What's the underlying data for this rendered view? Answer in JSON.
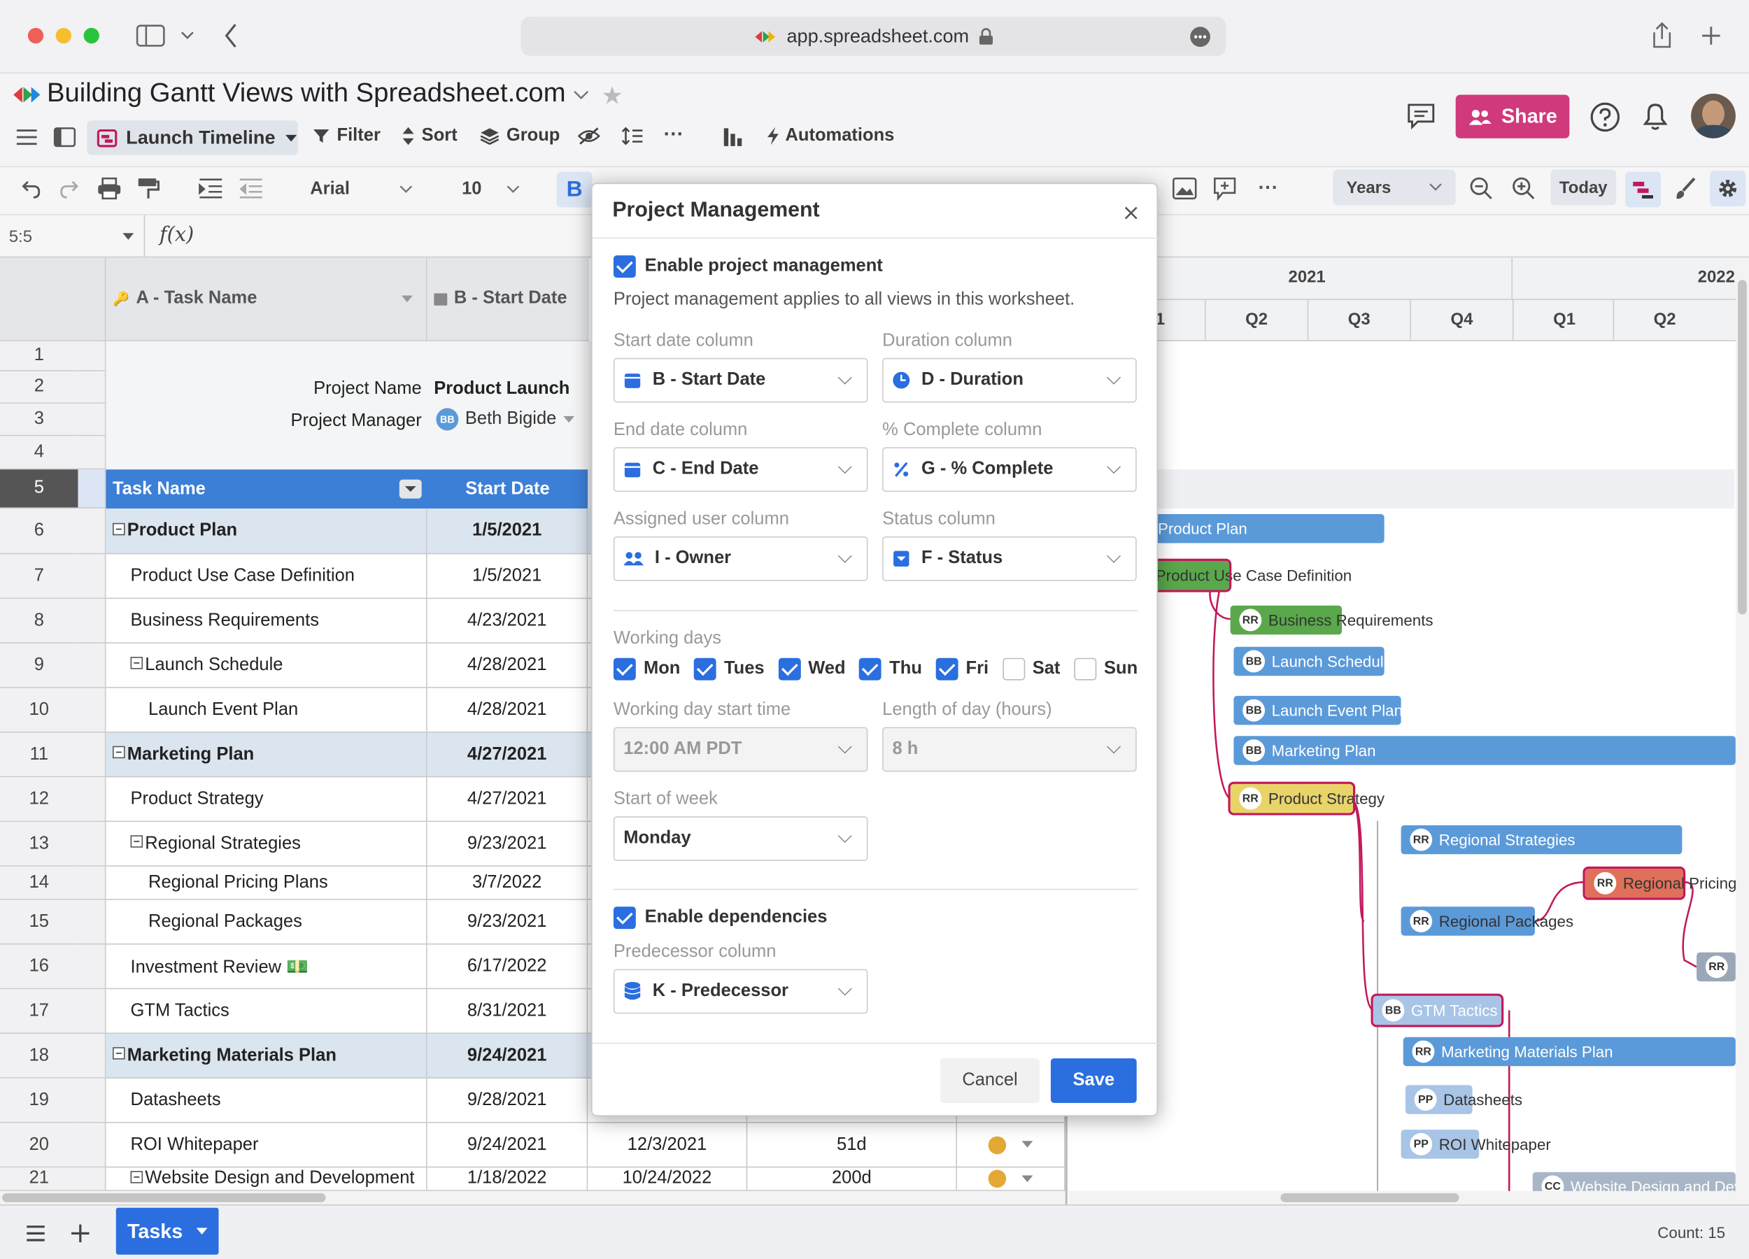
{
  "browser": {
    "url": "app.spreadsheet.com"
  },
  "header": {
    "title": "Building Gantt Views with Spreadsheet.com",
    "view_name": "Launch Timeline",
    "filter": "Filter",
    "sort": "Sort",
    "group": "Group",
    "automations": "Automations",
    "share": "Share"
  },
  "format_bar": {
    "font": "Arial",
    "size": "10",
    "zoom_unit": "Years",
    "today": "Today"
  },
  "formula_bar": {
    "cell_ref": "5:5",
    "fx": "f(x)"
  },
  "columns": {
    "a": "A - Task Name",
    "b": "B - Start Date"
  },
  "project_info": {
    "name_label": "Project Name",
    "name_value": "Product Launch",
    "manager_label": "Project Manager",
    "manager_value": "Beth Bigide",
    "manager_initials": "BB"
  },
  "table_header": {
    "task": "Task Name",
    "start": "Start Date"
  },
  "rows": [
    {
      "n": "1"
    },
    {
      "n": "2"
    },
    {
      "n": "3"
    },
    {
      "n": "4"
    },
    {
      "n": "5"
    },
    {
      "n": "6",
      "task": "Product Plan",
      "start": "1/5/2021",
      "group": true
    },
    {
      "n": "7",
      "task": "Product Use Case Definition",
      "start": "1/5/2021"
    },
    {
      "n": "8",
      "task": "Business Requirements",
      "start": "4/23/2021"
    },
    {
      "n": "9",
      "task": "Launch Schedule",
      "start": "4/28/2021",
      "sub": true
    },
    {
      "n": "10",
      "task": "Launch Event Plan",
      "start": "4/28/2021",
      "indent": true
    },
    {
      "n": "11",
      "task": "Marketing Plan",
      "start": "4/27/2021",
      "group": true
    },
    {
      "n": "12",
      "task": "Product Strategy",
      "start": "4/27/2021"
    },
    {
      "n": "13",
      "task": "Regional Strategies",
      "start": "9/23/2021",
      "sub": true
    },
    {
      "n": "14",
      "task": "Regional Pricing Plans",
      "start": "3/7/2022",
      "indent": true
    },
    {
      "n": "15",
      "task": "Regional Packages",
      "start": "9/23/2021",
      "indent": true
    },
    {
      "n": "16",
      "task": "Investment Review 💵",
      "start": "6/17/2022"
    },
    {
      "n": "17",
      "task": "GTM Tactics",
      "start": "8/31/2021"
    },
    {
      "n": "18",
      "task": "Marketing Materials Plan",
      "start": "9/24/2021",
      "group": true
    },
    {
      "n": "19",
      "task": "Datasheets",
      "start": "9/28/2021"
    },
    {
      "n": "20",
      "task": "ROI Whitepaper",
      "start": "9/24/2021",
      "end": "12/3/2021",
      "dur": "51d"
    },
    {
      "n": "21",
      "task": "Website Design and Development",
      "start": "1/18/2022",
      "end": "10/24/2022",
      "dur": "200d",
      "sub": true
    }
  ],
  "gantt": {
    "years": [
      "2021",
      "2022"
    ],
    "quarters": [
      "Q1",
      "Q2",
      "Q3",
      "Q4",
      "Q1",
      "Q2"
    ],
    "bars": [
      {
        "label": "Product Plan"
      },
      {
        "label": "Product Use Case Definition"
      },
      {
        "label": "Business Requirements",
        "initials": "RR"
      },
      {
        "label": "Launch Schedule",
        "initials": "BB"
      },
      {
        "label": "Launch Event Plan",
        "initials": "BB"
      },
      {
        "label": "Marketing Plan",
        "initials": "BB"
      },
      {
        "label": "Product Strategy",
        "initials": "RR"
      },
      {
        "label": "Regional Strategies",
        "initials": "RR"
      },
      {
        "label": "Regional Pricing Plans",
        "initials": "RR"
      },
      {
        "label": "Regional Packages",
        "initials": "RR"
      },
      {
        "label": "",
        "initials": "RR"
      },
      {
        "label": "GTM Tactics",
        "initials": "BB"
      },
      {
        "label": "Marketing Materials Plan",
        "initials": "RR"
      },
      {
        "label": "Datasheets",
        "initials": "PP"
      },
      {
        "label": "ROI Whitepaper",
        "initials": "PP"
      },
      {
        "label": "Website Design and Development",
        "initials": "CC"
      }
    ],
    "colors": {
      "blue": "#5b9ad9",
      "green": "#5aa84b",
      "yellow": "#e9d46a",
      "red": "#e0705a",
      "link": "#c2185b"
    }
  },
  "modal": {
    "title": "Project Management",
    "enable_pm": "Enable project management",
    "pm_note": "Project management applies to all views in this worksheet.",
    "start_label": "Start date column",
    "start_value": "B - Start Date",
    "duration_label": "Duration column",
    "duration_value": "D - Duration",
    "end_label": "End date column",
    "end_value": "C - End Date",
    "complete_label": "% Complete column",
    "complete_value": "G - % Complete",
    "user_label": "Assigned user column",
    "user_value": "I - Owner",
    "status_label": "Status column",
    "status_value": "F - Status",
    "working_days_label": "Working days",
    "days": [
      {
        "name": "Mon",
        "checked": true
      },
      {
        "name": "Tues",
        "checked": true
      },
      {
        "name": "Wed",
        "checked": true
      },
      {
        "name": "Thu",
        "checked": true
      },
      {
        "name": "Fri",
        "checked": true
      },
      {
        "name": "Sat",
        "checked": false
      },
      {
        "name": "Sun",
        "checked": false
      }
    ],
    "start_time_label": "Working day start time",
    "start_time_value": "12:00 AM PDT",
    "day_length_label": "Length of day (hours)",
    "day_length_value": "8 h",
    "week_start_label": "Start of week",
    "week_start_value": "Monday",
    "enable_deps": "Enable dependencies",
    "predecessor_label": "Predecessor column",
    "predecessor_value": "K - Predecessor",
    "cancel": "Cancel",
    "save": "Save"
  },
  "bottom": {
    "sheet_tab": "Tasks",
    "count": "Count: 15"
  }
}
